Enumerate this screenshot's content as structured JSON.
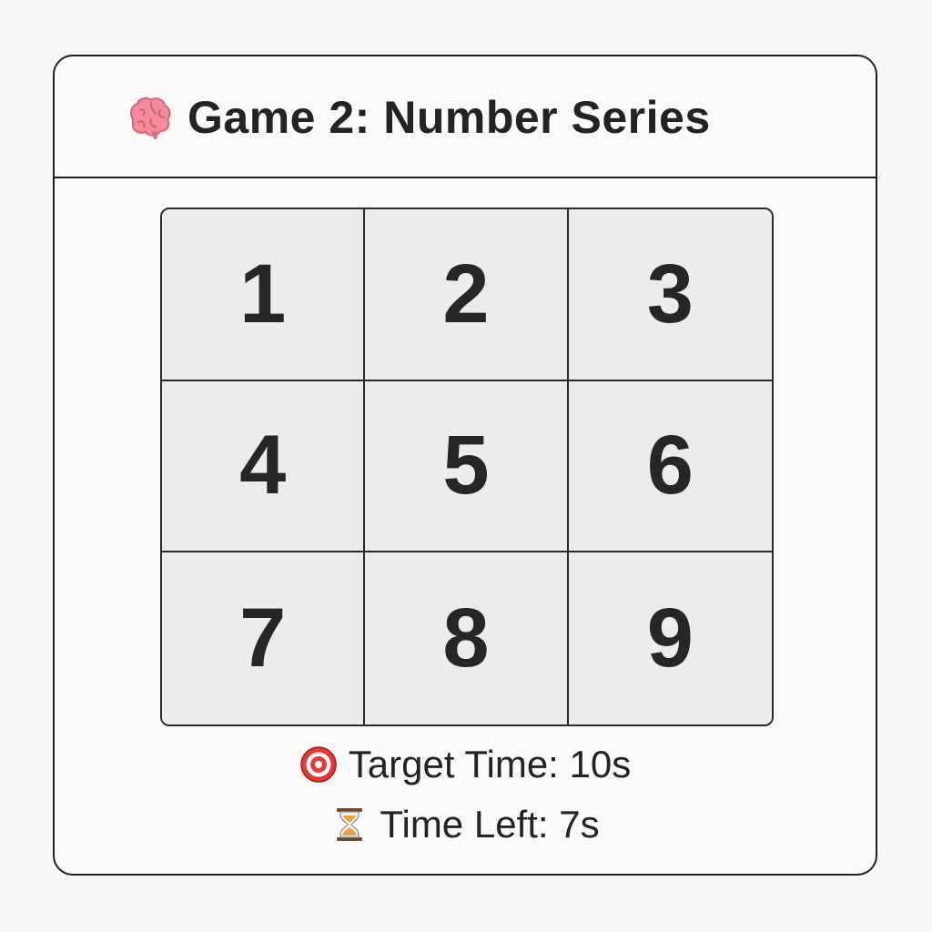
{
  "header": {
    "title": "Game 2: Number Series",
    "icon": "brain-icon"
  },
  "grid": {
    "cells": [
      "1",
      "2",
      "3",
      "4",
      "5",
      "6",
      "7",
      "8",
      "9"
    ]
  },
  "status": {
    "target_time_label": "Target Time: 10s",
    "target_icon": "target-icon",
    "time_left_label": "Time Left: 7s",
    "time_left_icon": "hourglass-icon"
  },
  "colors": {
    "brain": "#f28b9a",
    "target_red": "#e53935",
    "hourglass_sand": "#e8a33d",
    "hourglass_frame": "#6b4a2b"
  }
}
